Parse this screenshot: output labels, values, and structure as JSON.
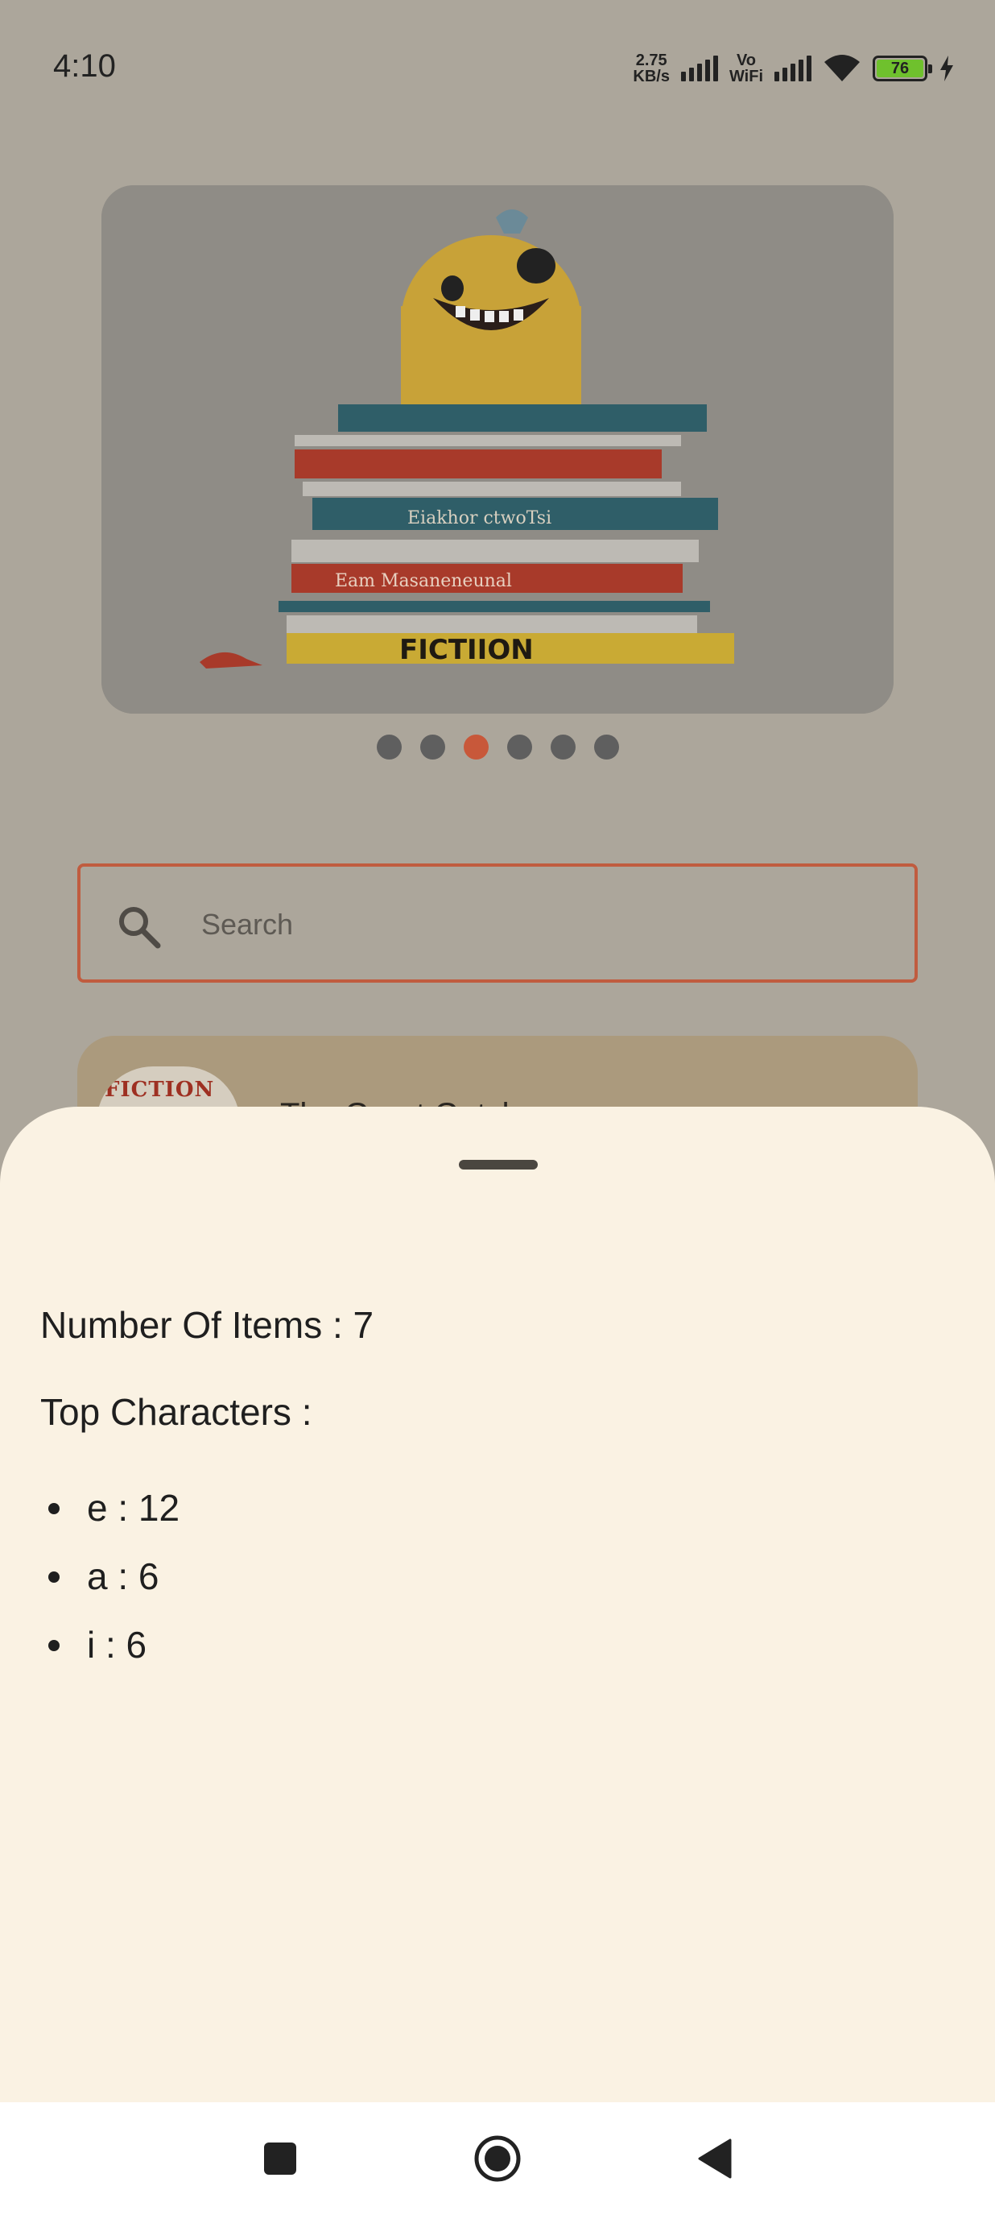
{
  "status_bar": {
    "time": "4:10",
    "net_speed_value": "2.75",
    "net_speed_unit": "KB/s",
    "vowifi_top": "Vo",
    "vowifi_bottom": "WiFi",
    "battery_level": "76"
  },
  "carousel": {
    "image_icon": "books-stack-monster-image",
    "image_caption": "FICTIION",
    "page_count": 6,
    "active_index": 2
  },
  "search": {
    "placeholder": "Search",
    "value": ""
  },
  "list": {
    "items": [
      {
        "thumb_text": "FICTION",
        "title": "The Great Gatsby"
      }
    ]
  },
  "sheet": {
    "items_count_text": "Number Of Items : 7",
    "top_characters_label": "Top Characters :",
    "top_characters": [
      {
        "text": "e : 12"
      },
      {
        "text": "a : 6"
      },
      {
        "text": "i : 6"
      }
    ]
  },
  "nav_bar": {
    "recent_icon": "square-icon",
    "home_icon": "circle-icon",
    "back_icon": "triangle-back-icon"
  },
  "colors": {
    "accent": "#c8583a",
    "sheet_bg": "#faf2e3",
    "scrim_bg": "#aca69b"
  }
}
